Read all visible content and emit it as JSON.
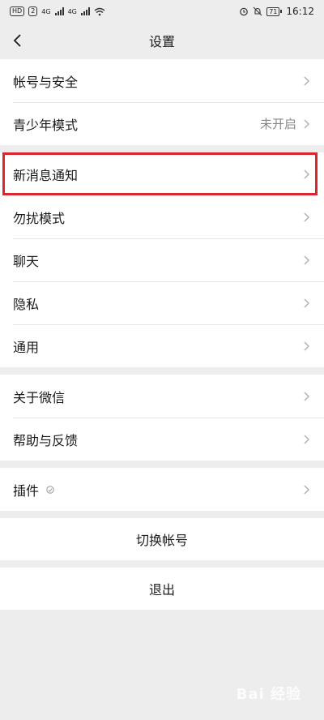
{
  "status_bar": {
    "left": {
      "hd": "HD",
      "sim": "2",
      "net1": "4G",
      "net2": "4G"
    },
    "right": {
      "battery": "71",
      "time": "16:12"
    }
  },
  "nav": {
    "title": "设置"
  },
  "groups": [
    {
      "items": [
        {
          "label": "帐号与安全"
        },
        {
          "label": "青少年模式",
          "value": "未开启"
        }
      ]
    },
    {
      "items": [
        {
          "label": "新消息通知",
          "highlighted": true
        },
        {
          "label": "勿扰模式"
        },
        {
          "label": "聊天"
        },
        {
          "label": "隐私"
        },
        {
          "label": "通用"
        }
      ]
    },
    {
      "items": [
        {
          "label": "关于微信"
        },
        {
          "label": "帮助与反馈"
        }
      ]
    },
    {
      "items": [
        {
          "label": "插件"
        }
      ]
    }
  ],
  "actions": {
    "switch_account": "切换帐号",
    "logout": "退出"
  },
  "watermark": "Bai 经验",
  "colors": {
    "background": "#ededed",
    "highlight": "#d9262f"
  }
}
